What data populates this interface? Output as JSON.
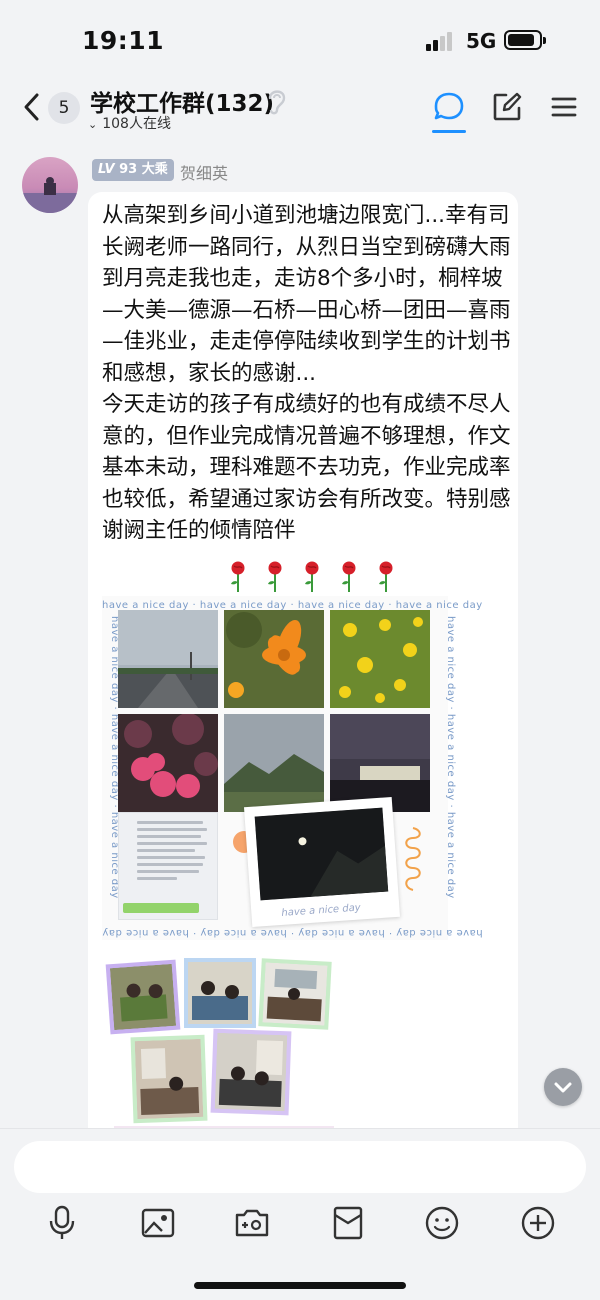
{
  "status_bar": {
    "time": "19:11",
    "network": "5G"
  },
  "header": {
    "unread_count": "5",
    "title": "学校工作群(132)",
    "online_count": "108人在线",
    "icons": [
      "back-icon",
      "earphone-icon",
      "chat-bubble-icon",
      "edit-icon",
      "menu-icon"
    ],
    "accent_color": "#1e90ff"
  },
  "message": {
    "level_label": "LV",
    "level_number": "93",
    "level_title": "大乘",
    "sender": "贺细英",
    "text": "从高架到乡间小道到池塘边限宽门...幸有司长阙老师一路同行，从烈日当空到磅礴大雨到月亮走我也走，走访8个多小时，桐梓坡—大美—德源—石桥—田心桥—团田—喜雨—佳兆业，走走停停陆续收到学生的计划书和感想，家长的感谢...\n今天走访的孩子有成绩好的也有成绩不尽人意的，但作业完成情况普遍不够理想，作文基本未动，理科难题不去功克，作业完成率也较低，希望通过家访会有所改变。特别感谢阙主任的倾情陪伴",
    "rose_emoji_count": 5,
    "collage_border_text": "have a nice day",
    "polaroid_caption": "have a nice day",
    "chat_screenshot_lines": [
      "我老师，非常感谢您的家访。孩子在家中比较懒，我们家长说他也只是敷衍了事。",
      "当然我们家长也有责任，家校联合让这个问题得到改善，以便她能更好地完成作业，今天辛苦了，感谢！",
      "不客气，教师让孩子较好的"
    ]
  },
  "input": {
    "toolbar_icons": [
      "microphone-icon",
      "image-icon",
      "camera-icon",
      "red-packet-icon",
      "emoji-icon",
      "plus-icon"
    ]
  }
}
